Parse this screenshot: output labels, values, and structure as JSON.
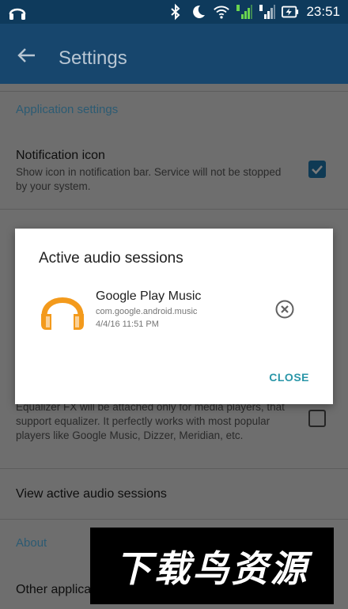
{
  "status_bar": {
    "time": "23:51",
    "icons": [
      "headphones-icon",
      "bluetooth-icon",
      "moon-icon",
      "wifi-icon",
      "signal-1-icon",
      "signal-2-icon",
      "battery-charging-icon"
    ]
  },
  "app_bar": {
    "back_icon": "arrow-back-icon",
    "title": "Settings"
  },
  "settings": {
    "application_section": "Application settings",
    "notification_icon": {
      "title": "Notification icon",
      "description": "Show icon in notification bar. Service will not be stopped by your system.",
      "checked": true
    },
    "equalizer_description": "Equalizer FX will be attached only for media players, that support equalizer. It perfectly works with most popular players like Google Music, Dizzer, Meridian, etc.",
    "equalizer_checked": false,
    "view_sessions": "View active audio sessions",
    "about_section": "About",
    "other_apps": "Other applica"
  },
  "dialog": {
    "title": "Active audio sessions",
    "session": {
      "app_name": "Google Play Music",
      "package": "com.google.android.music",
      "timestamp": "4/4/16 11:51 PM",
      "icon": "headphones-icon"
    },
    "remove_icon": "close-circle-icon",
    "close_label": "CLOSE"
  },
  "watermark": {
    "text": "下载鸟资源"
  },
  "colors": {
    "status_bar": "#0e3a5c",
    "app_bar": "#17466d",
    "scrim_background": "#6e6e6e",
    "accent": "#2a96a8",
    "headphone_orange": "#f39a1c"
  }
}
